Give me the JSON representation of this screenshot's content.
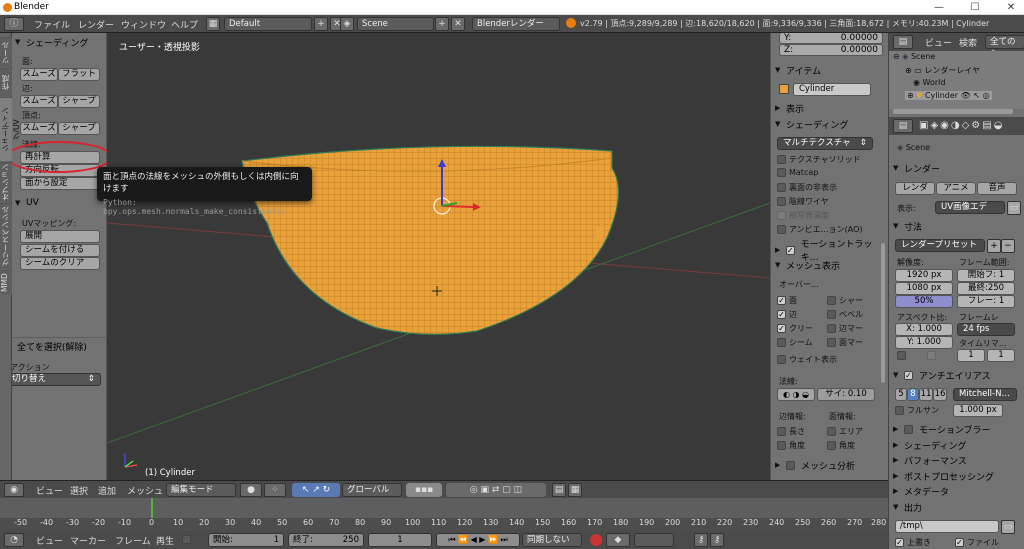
{
  "window": {
    "title": "Blender",
    "min": "—",
    "max": "☐",
    "close": "✕"
  },
  "infobar": {
    "menus": [
      "ファイル",
      "レンダー",
      "ウィンドウ",
      "ヘルプ"
    ],
    "layout": "Default",
    "scene": "Scene",
    "engine": "Blenderレンダー",
    "stats": "v2.79 | 頂点:9,289/9,289 | 辺:18,620/18,620 | 面:9,336/9,336 | 三角面:18,672 | メモリ:40.23M | Cylinder"
  },
  "tabs": [
    "ツール",
    "作成",
    "シェーディング/UV",
    "オプション",
    "グリースペンシル",
    "MMD"
  ],
  "toolshelf": {
    "shading": {
      "title": "シェーディング",
      "face": "面:",
      "edge": "辺:",
      "vertex": "頂点:",
      "smooth": "スムーズ",
      "flat": "フラット",
      "sharp": "シャープ",
      "normals": "法線:",
      "recalc": "再計算",
      "flip": "方向反転",
      "from_face": "面から設定"
    },
    "uv": {
      "title": "UV",
      "mapping": "UVマッピング:",
      "unwrap": "展開",
      "mark": "シームを付ける",
      "clear": "シームのクリア"
    },
    "last_op": {
      "title": "全てを選択(解除)",
      "action": "アクション",
      "value": "切り替え"
    }
  },
  "viewport": {
    "label": "ユーザー・透視投影",
    "object": "(1) Cylinder"
  },
  "tooltip": {
    "text": "面と頂点の法線をメッシュの外側もしくは内側に向けます",
    "python": "Python: bpy.ops.mesh.normals_make_consistent()"
  },
  "npanel": {
    "y": "Y:",
    "y_val": "0.00000",
    "z": "Z:",
    "z_val": "0.00000",
    "item": "アイテム",
    "item_name": "Cylinder",
    "display": "表示",
    "shading": "シェーディング",
    "shading_mode": "マルチテクスチャ",
    "opts": [
      "テクスチャソリッド",
      "Matcap",
      "裏面の非表示",
      "陰線ワイヤ",
      "被写界深度",
      "アンビエ…ョン(AO)"
    ],
    "motion": "モーショントラッキ…",
    "mesh_display": "メッシュ表示",
    "overlays": "オーバー…",
    "ov": [
      [
        "面",
        "シャー"
      ],
      [
        "辺",
        "ベベル"
      ],
      [
        "クリー",
        "辺マー"
      ],
      [
        "シーム",
        "面マー"
      ]
    ],
    "weight": "ウェイト表示",
    "normals": "法線:",
    "size": "サイ: 0.10",
    "edge_info": "辺情報:",
    "face_info": "面情報:",
    "length": "長さ",
    "area": "エリア",
    "angle": "角度",
    "angle2": "角度",
    "analysis": "メッシュ分析"
  },
  "props": {
    "view": "ビュー",
    "search": "検索",
    "all": "全てのシ",
    "outliner": [
      "Scene",
      "レンダーレイヤ",
      "World",
      "Cylinder"
    ],
    "scene": "Scene",
    "render": "レンダー",
    "render_btn": "レンダ",
    "anim_btn": "アニメ",
    "audio_btn": "音声",
    "display": "表示:",
    "display_val": "UV画像エデ",
    "dims": "寸法",
    "preset": "レンダープリセット",
    "res": "解像度:",
    "frame_range": "フレーム範囲:",
    "resx": "1920 px",
    "resy": "1080 px",
    "pct": "50%",
    "start": "開始フ: 1",
    "end": "最終:250",
    "step": "フレー: 1",
    "aspect": "アスペクト比:",
    "fps_label": "フレームレ",
    "ax": "X: 1.000",
    "ay": "Y: 1.000",
    "fps": "24 fps",
    "remap": "タイムリマ…",
    "remap_val": "1",
    "aa": "アンチエイリアス",
    "aa_vals": [
      "5",
      "8",
      "11",
      "16"
    ],
    "filter": "Mitchell-N…",
    "full": "フルサン",
    "full_val": "1.000 px",
    "sections": [
      "モーションブラー",
      "シェーディング",
      "パフォーマンス",
      "ポストプロセッシング",
      "メタデータ"
    ],
    "output": "出力",
    "path": "/tmp\\",
    "overwrite": "上書き",
    "file": "ファイル"
  },
  "vpheader": {
    "view": "ビュー",
    "select": "選択",
    "add": "追加",
    "mesh": "メッシュ",
    "mode": "編集モード",
    "orient": "グローバル"
  },
  "timeline": {
    "ticks": [
      "-50",
      "-40",
      "-30",
      "-20",
      "-10",
      "0",
      "10",
      "20",
      "30",
      "40",
      "50",
      "60",
      "70",
      "80",
      "90",
      "100",
      "110",
      "120",
      "130",
      "140",
      "150",
      "160",
      "170",
      "180",
      "190",
      "200",
      "210",
      "220",
      "230",
      "240",
      "250",
      "260",
      "270",
      "280"
    ]
  },
  "tlfoot": {
    "view": "ビュー",
    "marker": "マーカー",
    "frame": "フレーム",
    "play": "再生",
    "start": "開始:",
    "start_val": "1",
    "end": "終了:",
    "end_val": "250",
    "current": "1",
    "sync": "同期しない"
  }
}
